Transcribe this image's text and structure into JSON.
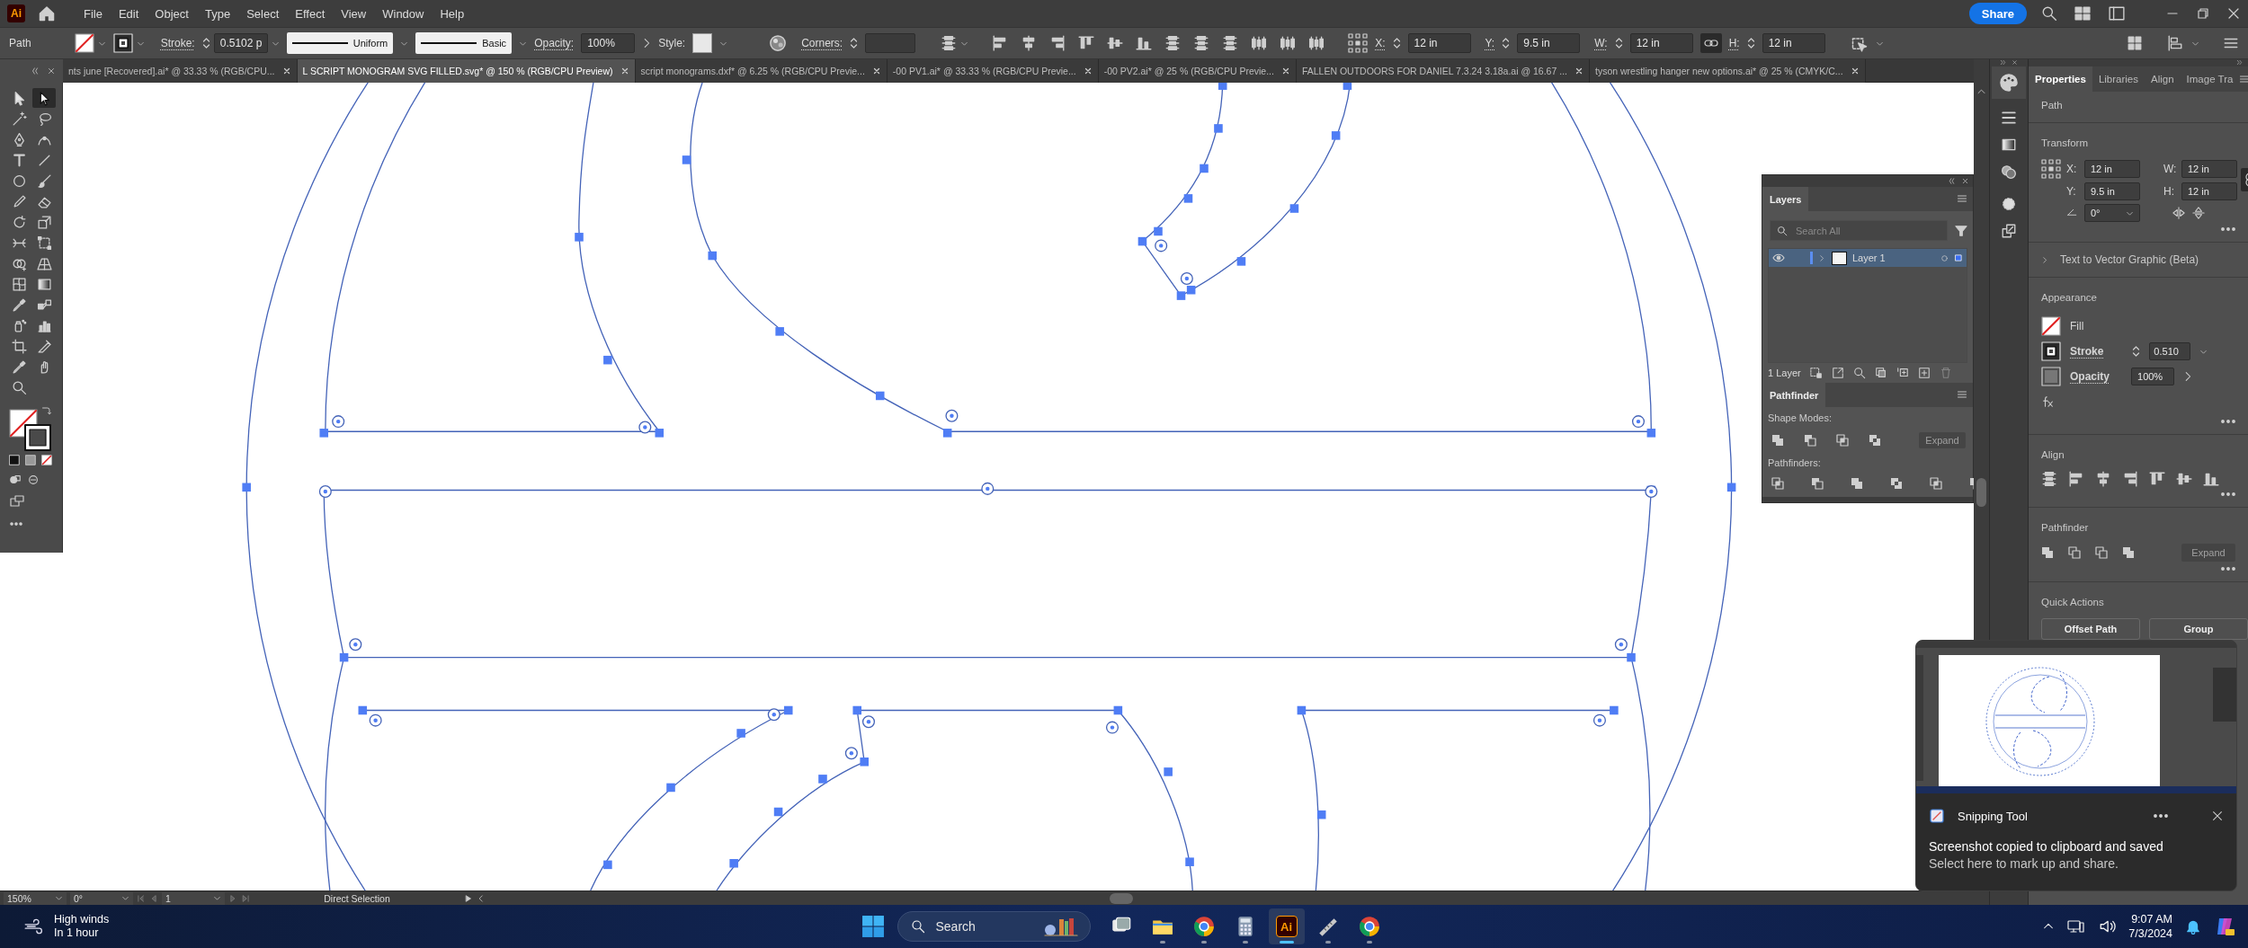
{
  "app_logo": "Ai",
  "menu": [
    "File",
    "Edit",
    "Object",
    "Type",
    "Select",
    "Effect",
    "View",
    "Window",
    "Help"
  ],
  "share_button": "Share",
  "control_bar": {
    "selection_type": "Path",
    "stroke_label": "Stroke:",
    "stroke_weight": "0.5102 p",
    "profile": "Uniform",
    "brush": "Basic",
    "opacity_label": "Opacity:",
    "opacity": "100%",
    "style_label": "Style:",
    "corners_label": "Corners:",
    "x_label": "X:",
    "x": "12 in",
    "y_label": "Y:",
    "y": "9.5 in",
    "w_label": "W:",
    "w": "12 in",
    "h_label": "H:",
    "h": "12 in"
  },
  "document_tabs": [
    {
      "label": "nts june [Recovered].ai* @ 33.33 % (RGB/CPU...",
      "selected": false
    },
    {
      "label": "L SCRIPT MONOGRAM SVG FILLED.svg* @ 150 % (RGB/CPU Preview)",
      "selected": true
    },
    {
      "label": "script monograms.dxf* @ 6.25 % (RGB/CPU Previe...",
      "selected": false
    },
    {
      "label": "-00 PV1.ai* @ 33.33 % (RGB/CPU Previe...",
      "selected": false
    },
    {
      "label": "-00 PV2.ai* @ 25 % (RGB/CPU Previe...",
      "selected": false
    },
    {
      "label": "FALLEN OUTDOORS FOR DANIEL 7.3.24 3.18a.ai @ 16.67 ...",
      "selected": false
    },
    {
      "label": "tyson wrestling hanger new options.ai* @ 25 % (CMYK/C...",
      "selected": false
    }
  ],
  "tools": [
    {
      "kind": "selection",
      "selected": false
    },
    {
      "kind": "direct-selection",
      "selected": true
    },
    {
      "kind": "magic-wand",
      "selected": false
    },
    {
      "kind": "lasso",
      "selected": false
    },
    {
      "kind": "pen",
      "selected": false
    },
    {
      "kind": "curvature",
      "selected": false
    },
    {
      "kind": "type",
      "selected": false
    },
    {
      "kind": "line",
      "selected": false
    },
    {
      "kind": "ellipse",
      "selected": false
    },
    {
      "kind": "paintbrush",
      "selected": false
    },
    {
      "kind": "pencil",
      "selected": false
    },
    {
      "kind": "eraser",
      "selected": false
    },
    {
      "kind": "rotate",
      "selected": false
    },
    {
      "kind": "scale",
      "selected": false
    },
    {
      "kind": "width",
      "selected": false
    },
    {
      "kind": "free-transform",
      "selected": false
    },
    {
      "kind": "shape-builder",
      "selected": false
    },
    {
      "kind": "perspective",
      "selected": false
    },
    {
      "kind": "mesh",
      "selected": false
    },
    {
      "kind": "gradient",
      "selected": false
    },
    {
      "kind": "eyedropper",
      "selected": false
    },
    {
      "kind": "blend",
      "selected": false
    },
    {
      "kind": "symbol-sprayer",
      "selected": false
    },
    {
      "kind": "column-graph",
      "selected": false
    },
    {
      "kind": "artboard",
      "selected": false
    },
    {
      "kind": "slice",
      "selected": false
    },
    {
      "kind": "eyedropper",
      "selected": false
    },
    {
      "kind": "hand",
      "selected": false
    },
    {
      "kind": "zoom",
      "selected": false
    }
  ],
  "layers_panel": {
    "tab": "Layers",
    "search_placeholder": "Search All",
    "layers": [
      {
        "name": "Layer 1",
        "selected": true,
        "visible": true
      }
    ],
    "layer_count": "1 Layer"
  },
  "pathfinder_panel": {
    "tab": "Pathfinder",
    "shape_modes_label": "Shape Modes:",
    "expand_button": {
      "label": "Expand",
      "disabled": true
    },
    "pathfinders_label": "Pathfinders:"
  },
  "properties_panel": {
    "tabs": [
      {
        "label": "Properties",
        "selected": true
      },
      {
        "label": "Libraries",
        "selected": false
      },
      {
        "label": "Align",
        "selected": false
      },
      {
        "label": "Image Tra",
        "selected": false
      }
    ],
    "selection_type": "Path",
    "transform": {
      "title": "Transform",
      "x_label": "X:",
      "x": "12 in",
      "y_label": "Y:",
      "y": "9.5 in",
      "w_label": "W:",
      "w": "12 in",
      "h_label": "H:",
      "h": "12 in",
      "angle": "0°"
    },
    "text_to_vector": "Text to Vector Graphic (Beta)",
    "appearance": {
      "title": "Appearance",
      "fill_label": "Fill",
      "stroke_label": "Stroke",
      "stroke_weight": "0.510",
      "opacity_label": "Opacity",
      "opacity": "100%"
    },
    "align_title": "Align",
    "pathfinder": {
      "title": "Pathfinder",
      "expand_button": {
        "label": "Expand",
        "disabled": true
      }
    },
    "quick_actions": {
      "title": "Quick Actions",
      "buttons": [
        "Offset Path",
        "Group"
      ]
    }
  },
  "status_bar": {
    "zoom": "150%",
    "rotation": "0°",
    "artboard": "1",
    "tool": "Direct Selection"
  },
  "taskbar": {
    "weather": {
      "title": "High winds",
      "subtitle": "In 1 hour"
    },
    "search_placeholder": "Search",
    "apps": [
      {
        "kind": "task-view",
        "selected": false
      },
      {
        "kind": "folder",
        "selected": false
      },
      {
        "kind": "chrome",
        "selected": false
      },
      {
        "kind": "calculator",
        "selected": false
      },
      {
        "kind": "illustrator",
        "label": "Ai",
        "selected": true
      },
      {
        "kind": "ruler",
        "selected": false
      },
      {
        "kind": "chrome",
        "selected": false
      }
    ],
    "time": "9:07 AM",
    "date": "7/3/2024"
  },
  "notification": {
    "app": "Snipping Tool",
    "title": "Screenshot copied to clipboard and saved",
    "body": "Select here to mark up and share."
  }
}
